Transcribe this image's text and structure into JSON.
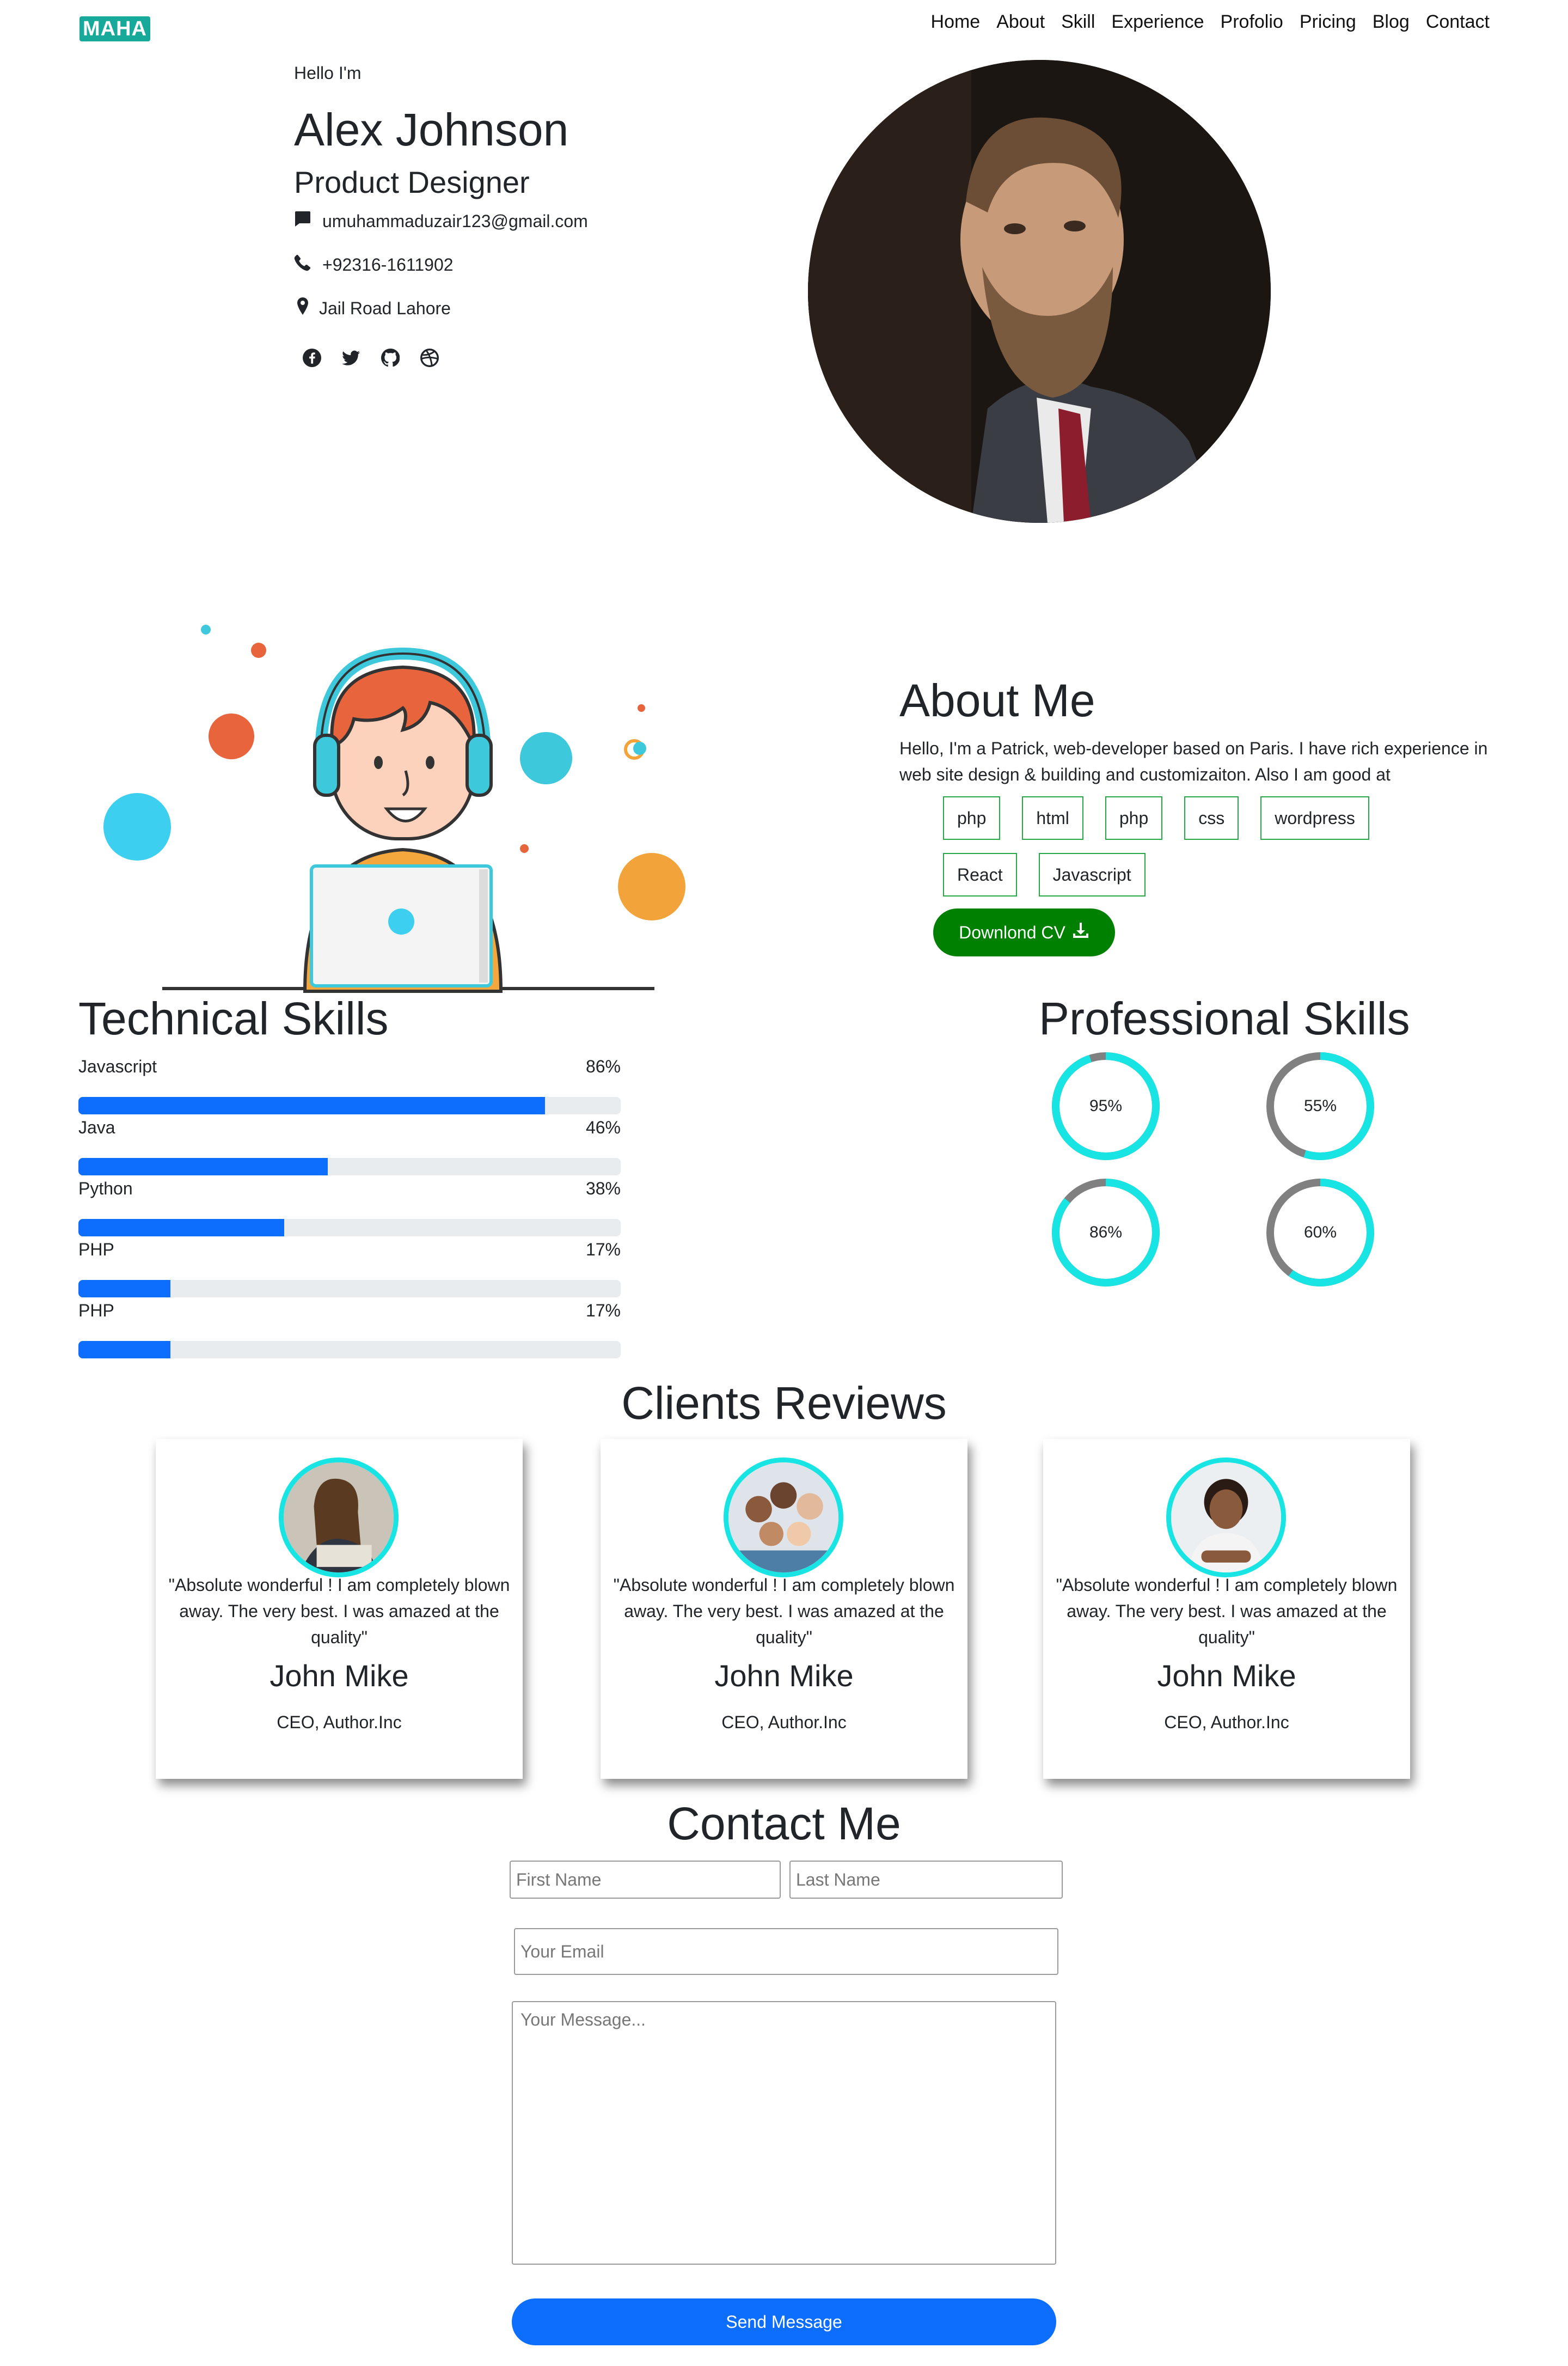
{
  "nav": {
    "logo": "MAHA",
    "links": [
      "Home",
      "About",
      "Skill",
      "Experience",
      "Profolio",
      "Pricing",
      "Blog",
      "Contact"
    ]
  },
  "hero": {
    "greeting": "Hello I'm",
    "name": "Alex Johnson",
    "role": "Product Designer",
    "email": "umuhammaduzair123@gmail.com",
    "phone": "+92316-1611902",
    "address": "Jail Road Lahore",
    "social_icons": [
      "facebook-icon",
      "twitter-icon",
      "github-icon",
      "dribbble-icon"
    ]
  },
  "about": {
    "title": "About Me",
    "text": "Hello, I'm a Patrick, web-developer based on Paris. I have rich experience in web site design & building and customizaiton. Also I am good at",
    "tags": [
      "php",
      "html",
      "php",
      "css",
      "wordpress",
      "React",
      "Javascript"
    ],
    "cv_button": "Downlond CV"
  },
  "technical_skills": {
    "title": "Technical Skills",
    "items": [
      {
        "name": "Javascript",
        "percent_label": "86%",
        "percent": 86
      },
      {
        "name": "Java",
        "percent_label": "46%",
        "percent": 46
      },
      {
        "name": "Python",
        "percent_label": "38%",
        "percent": 38
      },
      {
        "name": "PHP",
        "percent_label": "17%",
        "percent": 17
      },
      {
        "name": "PHP",
        "percent_label": "17%",
        "percent": 17
      }
    ]
  },
  "professional_skills": {
    "title": "Professional Skills",
    "items": [
      {
        "label": "95%",
        "percent": 95
      },
      {
        "label": "55%",
        "percent": 55
      },
      {
        "label": "86%",
        "percent": 86
      },
      {
        "label": "60%",
        "percent": 60
      }
    ],
    "ring_color": "#19e4e4",
    "track_color": "#808080"
  },
  "reviews": {
    "title": "Clients Reviews",
    "cards": [
      {
        "quote": "\"Absolute wonderful ! I am completely blown away. The very best. I was amazed at the quality\"",
        "name": "John Mike",
        "role": "CEO, Author.Inc"
      },
      {
        "quote": "\"Absolute wonderful ! I am completely blown away. The very best. I was amazed at the quality\"",
        "name": "John Mike",
        "role": "CEO, Author.Inc"
      },
      {
        "quote": "\"Absolute wonderful ! I am completely blown away. The very best. I was amazed at the quality\"",
        "name": "John Mike",
        "role": "CEO, Author.Inc"
      }
    ]
  },
  "contact": {
    "title": "Contact Me",
    "first_name_placeholder": "First Name",
    "last_name_placeholder": "Last Name",
    "email_placeholder": "Your Email",
    "message_placeholder": "Your Message...",
    "send_button": "Send Message"
  },
  "colors": {
    "accent": "#0d6efd",
    "tag_border": "#28a745",
    "cv_button": "#008000",
    "logo": "#17a99a"
  }
}
